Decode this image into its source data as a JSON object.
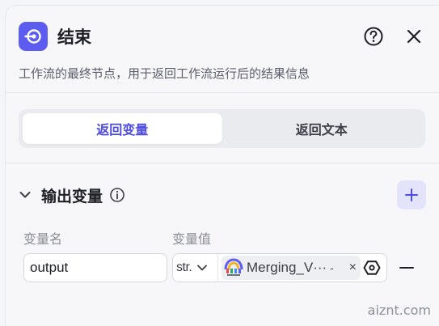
{
  "header": {
    "title": "结束",
    "description": "工作流的最终节点，用于返回工作流运行后的结果信息"
  },
  "segment": {
    "tabs": [
      {
        "label": "返回变量",
        "active": true
      },
      {
        "label": "返回文本",
        "active": false
      }
    ]
  },
  "output_section": {
    "title": "输出变量",
    "col_name_label": "变量名",
    "col_value_label": "变量值",
    "rows": [
      {
        "name": "output",
        "type": "str.",
        "ref_label": "Merging_V···",
        "ref_suffix": "-",
        "remove_glyph": "×"
      }
    ]
  },
  "watermark": "aiznt.com",
  "colors": {
    "accent": "#4e4cde",
    "node_icon_bg": "#5d5cf0",
    "add_btn_bg": "#e3e3fb"
  }
}
